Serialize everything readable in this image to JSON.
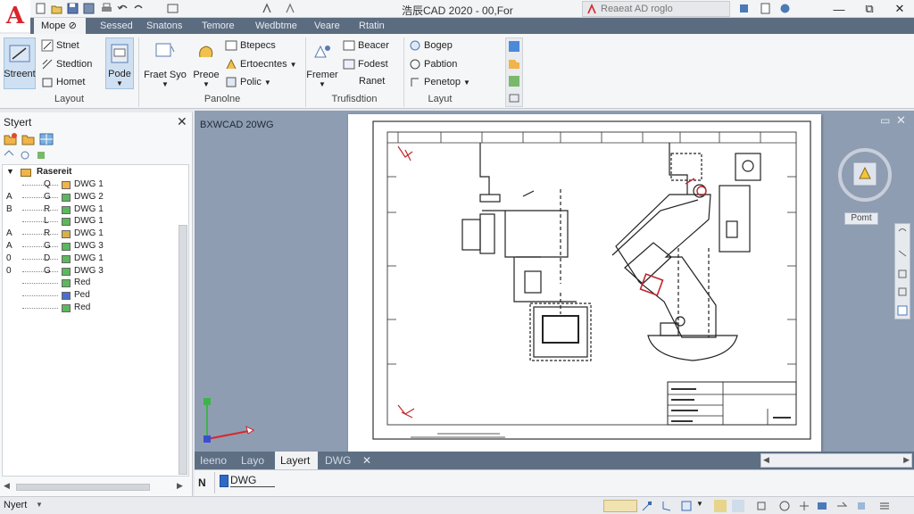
{
  "app": {
    "logo": "A",
    "title": "浩辰CAD 2020  -  00,For",
    "search_placeholder": "Reaeat AD roglo"
  },
  "window_controls": {
    "minimize": "—",
    "maximize": "⧉",
    "close": "✕"
  },
  "ribbon_tabs": [
    {
      "label": "Mope ⊘",
      "active": true
    },
    {
      "label": "Sessed",
      "active": false
    },
    {
      "label": "Snatons",
      "active": false
    },
    {
      "label": "Temore",
      "active": false
    },
    {
      "label": "Wedbtme",
      "active": false
    },
    {
      "label": "Veare",
      "active": false
    },
    {
      "label": "Rtatin",
      "active": false
    }
  ],
  "ribbon": {
    "layout_group": {
      "big_button": "Streent",
      "items": [
        "Stnet",
        "Stedtion",
        "Homet"
      ],
      "label": "Layout"
    },
    "pode_button": "Pode",
    "panel2": {
      "buttons": [
        "Fraet Syo",
        "Preoe"
      ],
      "items": [
        "Btepecs",
        "Ertoecntes",
        "Polic"
      ],
      "label": "Panolne"
    },
    "panel3": {
      "big_button": "Fremer",
      "items": [
        "Beacer",
        "Fodest",
        "Ranet"
      ],
      "label": "Trufisdtion"
    },
    "panel4": {
      "items": [
        "Bogep",
        "Pabtion",
        "Penetop"
      ],
      "label": "Layut"
    }
  },
  "left_panel": {
    "title": "Styert",
    "root": "Rasereit",
    "rows": [
      {
        "c1": "",
        "c2": "Q",
        "color": "#f0b44a",
        "label": "DWG 1"
      },
      {
        "c1": "A",
        "c2": "G",
        "color": "#5cb85c",
        "label": "DWG 2"
      },
      {
        "c1": "B",
        "c2": "R",
        "color": "#5cb85c",
        "label": "DWG 1"
      },
      {
        "c1": "",
        "c2": "L",
        "color": "#5cb85c",
        "label": "DWG 1"
      },
      {
        "c1": "A",
        "c2": "R",
        "color": "#d8b04a",
        "label": "DWG 1"
      },
      {
        "c1": "A",
        "c2": "G",
        "color": "#5cb85c",
        "label": "DWG 3"
      },
      {
        "c1": "0",
        "c2": "D",
        "color": "#5cb85c",
        "label": "DWG 1"
      },
      {
        "c1": "0",
        "c2": "G",
        "color": "#5cb85c",
        "label": "DWG 3"
      },
      {
        "c1": "",
        "c2": "",
        "color": "#5cb85c",
        "label": "Red"
      },
      {
        "c1": "",
        "c2": "",
        "color": "#4a6fd1",
        "label": "Ped"
      },
      {
        "c1": "",
        "c2": "",
        "color": "#5cb85c",
        "label": "Red"
      }
    ]
  },
  "viewport": {
    "label": "BXWCAD 20WG",
    "nav_label": "Pomt"
  },
  "layout_tabs": [
    {
      "label": "Ieeno",
      "active": false
    },
    {
      "label": "Layo",
      "active": false
    },
    {
      "label": "Layert",
      "active": true
    },
    {
      "label": "DWG",
      "active": false
    }
  ],
  "command_line": {
    "prompt": "N",
    "value": "DWG"
  },
  "status_bar": {
    "left_text": "Nyert"
  },
  "colors": {
    "accent": "#5b6c80",
    "viewport_bg": "#8f9db2",
    "logo_red": "#d8262b"
  }
}
